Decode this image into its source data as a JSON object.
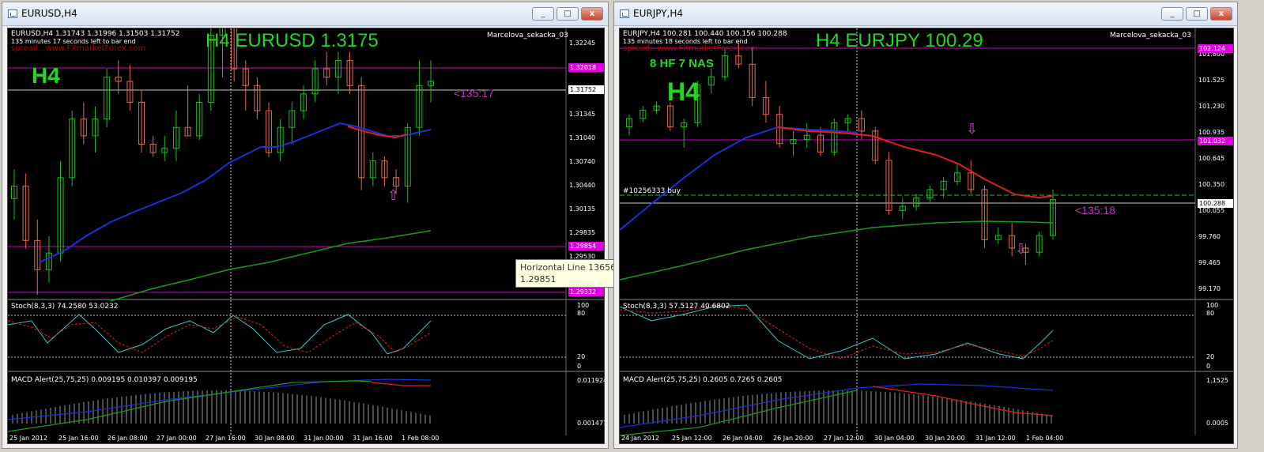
{
  "colors": {
    "bg": "#000000",
    "bull": "#16c416",
    "bear": "#e26a4a",
    "ma_fast": "#1f2fd8",
    "ma_mid": "#e02020",
    "ma_slow": "#1a9a1a",
    "hline": "#d000d0",
    "stoch_main": "#3cc7c7",
    "stoch_sig": "#e02020"
  },
  "left": {
    "title": "EURUSD,H4",
    "buttons": {
      "minimize": "_",
      "maximize": "□",
      "close": "x"
    },
    "ohlc": "EURUSD,H4  1.31743 1.31996 1.31503 1.31752",
    "timer": "135 minutes 17 seconds left to bar end",
    "watermark": "spread...www.FXmarketForex.com",
    "indicator_name": "Marcelova_sekacka_03",
    "headline": "H4 EURUSD 1.3175",
    "tf_label": "H4",
    "countdown": "<135:17",
    "price_scale": [
      "1.32245",
      "1.31945",
      "1.31645",
      "1.31345",
      "1.31040",
      "1.30740",
      "1.30440",
      "1.30135",
      "1.29835",
      "1.29530",
      "1.29230"
    ],
    "tag_top": "1.32018",
    "tag_current": "1.31752",
    "tag_mid": "1.29854",
    "tag_low": "1.29332",
    "stoch_label": "Stoch(8,3,3) 74.2580 53.0232",
    "stoch_scale": [
      "100",
      "80",
      "20",
      "0"
    ],
    "macd_label": "MACD Alert(25,75,25) 0.009195 0.010397 0.009195",
    "macd_scale": [
      "0.011924",
      "0.001477"
    ],
    "dates": [
      "25 Jan 2012",
      "25 Jan 16:00",
      "26 Jan 08:00",
      "27 Jan 00:00",
      "27 Jan 16:00",
      "30 Jan 08:00",
      "31 Jan 00:00",
      "31 Jan 16:00",
      "1 Feb 08:00"
    ],
    "tooltip": {
      "title": "Horizontal Line 13656",
      "value": "1.29851"
    }
  },
  "right": {
    "title": "EURJPY,H4",
    "buttons": {
      "minimize": "_",
      "maximize": "□",
      "close": "x"
    },
    "ohlc": "EURJPY,H4  100.281 100.440 100.156 100.288",
    "timer": "135 minutes 18 seconds left to bar end",
    "watermark": "spread...www.FXmarketForex.com",
    "indicator_name": "Marcelova_sekacka_03",
    "headline": "H4 EURJPY 100.29",
    "sub_headline": "8 HF 7 NAS",
    "tf_label": "H4",
    "countdown": "<135:18",
    "order_label": "#10256333 buy",
    "price_scale": [
      "101.800",
      "101.525",
      "101.230",
      "100.935",
      "100.645",
      "100.350",
      "100.055",
      "99.760",
      "99.465",
      "99.170"
    ],
    "tag_top": "102.124",
    "tag_mid": "101.032",
    "tag_current": "100.288",
    "stoch_label": "Stoch(8,3,3) 57.5127 40.6802",
    "stoch_scale": [
      "100",
      "80",
      "20",
      "0"
    ],
    "macd_label": "MACD Alert(25,75,25) 0.2605 0.7265 0.2605",
    "macd_scale": [
      "1.1525",
      "0.0005"
    ],
    "dates": [
      "24 Jan 2012",
      "25 Jan 12:00",
      "26 Jan 04:00",
      "26 Jan 20:00",
      "27 Jan 12:00",
      "30 Jan 04:00",
      "30 Jan 20:00",
      "31 Jan 12:00",
      "1 Feb 04:00"
    ]
  },
  "chart_data": [
    {
      "type": "candlestick",
      "symbol": "EURUSD",
      "timeframe": "H4",
      "candles": [
        [
          1.3035,
          1.307,
          1.301,
          1.305
        ],
        [
          1.305,
          1.3065,
          1.2975,
          1.2985
        ],
        [
          1.2985,
          1.301,
          1.292,
          1.295
        ],
        [
          1.295,
          1.299,
          1.2935,
          1.297
        ],
        [
          1.297,
          1.308,
          1.296,
          1.306
        ],
        [
          1.306,
          1.314,
          1.305,
          1.313
        ],
        [
          1.313,
          1.315,
          1.31,
          1.311
        ],
        [
          1.311,
          1.3145,
          1.309,
          1.313
        ],
        [
          1.313,
          1.319,
          1.312,
          1.318
        ],
        [
          1.318,
          1.32,
          1.316,
          1.3175
        ],
        [
          1.3175,
          1.3195,
          1.314,
          1.315
        ],
        [
          1.315,
          1.3165,
          1.309,
          1.31
        ],
        [
          1.31,
          1.311,
          1.3085,
          1.309
        ],
        [
          1.309,
          1.311,
          1.308,
          1.3095
        ],
        [
          1.3095,
          1.314,
          1.308,
          1.312
        ],
        [
          1.312,
          1.317,
          1.311,
          1.311
        ],
        [
          1.311,
          1.316,
          1.3105,
          1.315
        ],
        [
          1.315,
          1.324,
          1.314,
          1.323
        ],
        [
          1.323,
          1.325,
          1.318,
          1.324
        ],
        [
          1.324,
          1.325,
          1.3175,
          1.319
        ],
        [
          1.319,
          1.32,
          1.314,
          1.317
        ],
        [
          1.317,
          1.318,
          1.313,
          1.314
        ],
        [
          1.314,
          1.315,
          1.3085,
          1.309
        ],
        [
          1.309,
          1.313,
          1.308,
          1.312
        ],
        [
          1.312,
          1.315,
          1.31,
          1.314
        ],
        [
          1.314,
          1.317,
          1.313,
          1.316
        ],
        [
          1.316,
          1.32,
          1.315,
          1.319
        ],
        [
          1.319,
          1.321,
          1.317,
          1.318
        ],
        [
          1.318,
          1.321,
          1.316,
          1.32
        ],
        [
          1.32,
          1.321,
          1.316,
          1.317
        ],
        [
          1.317,
          1.318,
          1.3045,
          1.306
        ],
        [
          1.306,
          1.309,
          1.305,
          1.308
        ],
        [
          1.308,
          1.3085,
          1.305,
          1.306
        ],
        [
          1.306,
          1.307,
          1.304,
          1.305
        ],
        [
          1.305,
          1.3125,
          1.303,
          1.312
        ],
        [
          1.312,
          1.32,
          1.311,
          1.317
        ],
        [
          1.317,
          1.32,
          1.315,
          1.3175
        ]
      ],
      "ylim": [
        1.2923,
        1.3225
      ]
    },
    {
      "type": "candlestick",
      "symbol": "EURJPY",
      "timeframe": "H4",
      "candles": [
        [
          101.15,
          101.3,
          101.05,
          101.25
        ],
        [
          101.25,
          101.4,
          101.2,
          101.35
        ],
        [
          101.35,
          101.45,
          101.3,
          101.4
        ],
        [
          101.4,
          101.45,
          101.1,
          101.15
        ],
        [
          101.15,
          101.25,
          100.9,
          101.2
        ],
        [
          101.2,
          101.7,
          101.15,
          101.65
        ],
        [
          101.65,
          101.85,
          101.55,
          101.75
        ],
        [
          101.75,
          102.1,
          101.7,
          102.0
        ],
        [
          102.0,
          102.15,
          101.85,
          101.9
        ],
        [
          101.9,
          102.1,
          101.4,
          101.5
        ],
        [
          101.5,
          101.7,
          101.2,
          101.3
        ],
        [
          101.3,
          101.4,
          100.9,
          100.95
        ],
        [
          100.95,
          101.1,
          100.8,
          101.0
        ],
        [
          101.0,
          101.2,
          100.9,
          101.05
        ],
        [
          101.05,
          101.15,
          100.8,
          100.85
        ],
        [
          100.85,
          101.25,
          100.8,
          101.2
        ],
        [
          101.2,
          101.3,
          101.1,
          101.25
        ],
        [
          101.25,
          101.35,
          101.0,
          101.1
        ],
        [
          101.1,
          101.15,
          100.7,
          100.75
        ],
        [
          100.75,
          100.85,
          100.1,
          100.15
        ],
        [
          100.15,
          100.3,
          100.05,
          100.2
        ],
        [
          100.2,
          100.35,
          100.15,
          100.3
        ],
        [
          100.3,
          100.45,
          100.25,
          100.4
        ],
        [
          100.4,
          100.55,
          100.3,
          100.5
        ],
        [
          100.5,
          100.7,
          100.45,
          100.6
        ],
        [
          100.6,
          100.75,
          100.35,
          100.4
        ],
        [
          100.4,
          100.45,
          99.7,
          99.8
        ],
        [
          99.8,
          99.95,
          99.75,
          99.85
        ],
        [
          99.85,
          100.0,
          99.6,
          99.7
        ],
        [
          99.7,
          99.75,
          99.5,
          99.65
        ],
        [
          99.65,
          99.9,
          99.6,
          99.85
        ],
        [
          99.85,
          100.4,
          99.8,
          100.28
        ]
      ],
      "ylim": [
        99.17,
        102.12
      ]
    }
  ]
}
